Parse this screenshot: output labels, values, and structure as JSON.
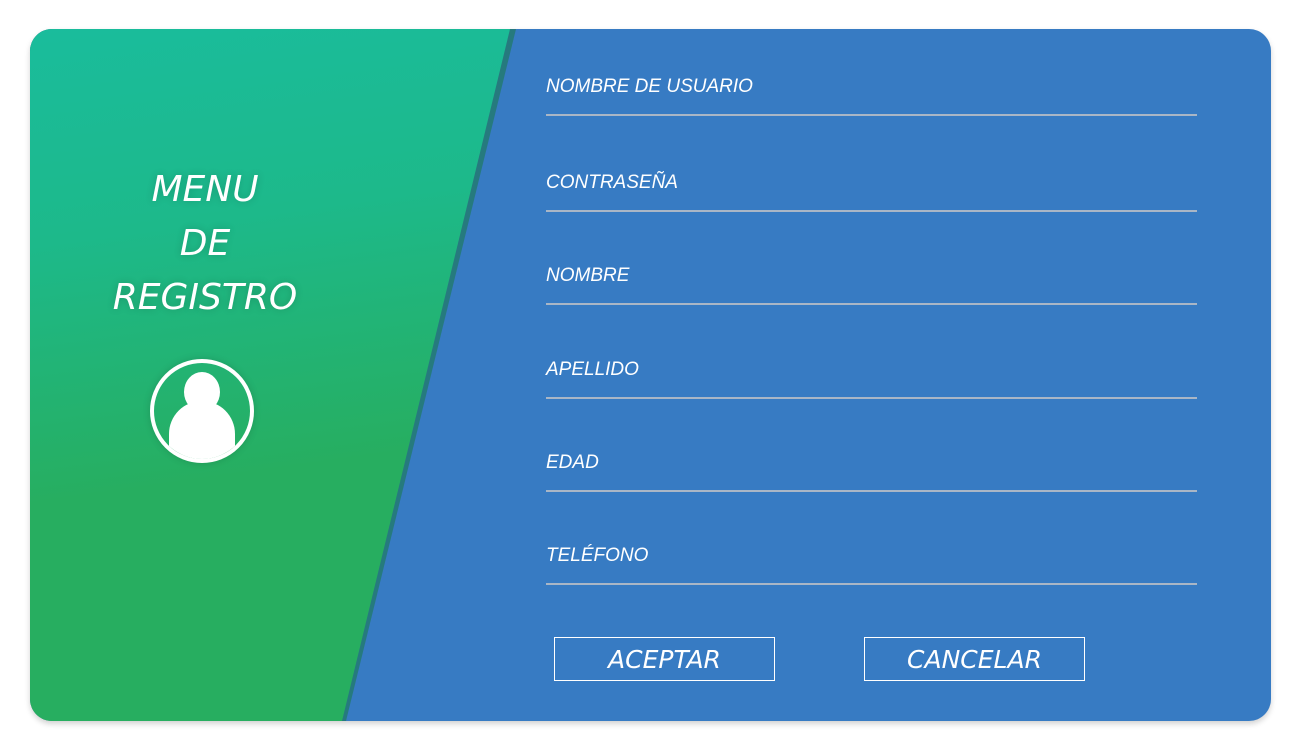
{
  "panel": {
    "title_lines": [
      "MENU",
      "DE",
      "REGISTRO"
    ],
    "avatar_icon": "user-avatar-icon"
  },
  "form": {
    "fields": [
      {
        "label": "NOMBRE DE USUARIO",
        "value": ""
      },
      {
        "label": "CONTRASEÑA",
        "value": ""
      },
      {
        "label": "NOMBRE",
        "value": ""
      },
      {
        "label": "APELLIDO",
        "value": ""
      },
      {
        "label": "EDAD",
        "value": ""
      },
      {
        "label": "TELÉFONO",
        "value": ""
      }
    ],
    "accept_label": "ACEPTAR",
    "cancel_label": "CANCELAR"
  },
  "colors": {
    "form_background": "#377bc3",
    "panel_gradient_top": "#1abc9c",
    "panel_gradient_bottom": "#27ae60",
    "underline": "#a9b6c6"
  }
}
